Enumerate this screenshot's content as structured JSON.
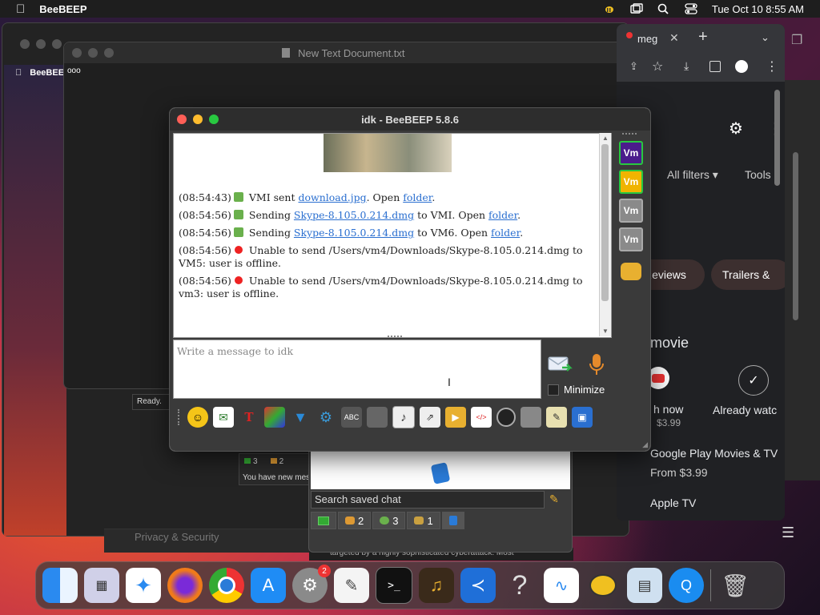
{
  "menubar": {
    "app_name": "BeeBEEP",
    "datetime": "Tue Oct 10  8:55 AM"
  },
  "background_windows": {
    "text_doc_title": "New Text Document.txt",
    "inner_app_name": "BeeBEEP",
    "status_ready": "Ready.",
    "notice_new_msg": "You have new mes",
    "notice_counts": [
      "3",
      "2"
    ],
    "privacy_label": "Privacy & Security",
    "news_snippet": "targeted by a highly sophisticated cyberattack. Most"
  },
  "chrome": {
    "tab_label": "meg",
    "all_filters": "All filters",
    "tools": "Tools",
    "chip_reviews": "Reviews",
    "chip_trailers": "Trailers &",
    "movie_heading": "movie",
    "watch_now": "h now",
    "price_1": "$3.99",
    "already_watched": "Already watc",
    "gp_title": "Google Play Movies & TV",
    "gp_price": "From $3.99",
    "apple_tv": "Apple TV"
  },
  "bee_window": {
    "title": "idk - BeeBEEP 5.8.6",
    "chat": [
      {
        "time": "(08:54:43)",
        "pre": " VMI sent ",
        "link1": "download.jpg",
        "mid": ". Open ",
        "link2": "folder",
        "post": ".",
        "kind": "dl"
      },
      {
        "time": "(08:54:56)",
        "pre": " Sending ",
        "link1": "Skype-8.105.0.214.dmg",
        "mid": " to VMI. Open ",
        "link2": "folder",
        "post": ".",
        "kind": "up"
      },
      {
        "time": "(08:54:56)",
        "pre": " Sending ",
        "link1": "Skype-8.105.0.214.dmg",
        "mid": " to VM6. Open ",
        "link2": "folder",
        "post": ".",
        "kind": "up"
      },
      {
        "time": "(08:54:56)",
        "text": " Unable to send /Users/vm4/Downloads/Skype-8.105.0.214.dmg to VM5: user is offline.",
        "kind": "err"
      },
      {
        "time": "(08:54:56)",
        "text": " Unable to send /Users/vm4/Downloads/Skype-8.105.0.214.dmg to vm3: user is offline.",
        "kind": "err"
      }
    ],
    "users": [
      {
        "label": "Vm",
        "color": "#4b1c8c",
        "border": "#28c840"
      },
      {
        "label": "Vm",
        "color": "#f0b400",
        "border": "#28c840"
      },
      {
        "label": "Vm",
        "color": "#8a8a8a",
        "border": "#aaaaaa"
      },
      {
        "label": "Vm",
        "color": "#8a8a8a",
        "border": "#aaaaaa"
      }
    ],
    "input_placeholder": "Write a message to idk",
    "minimize_label": "Minimize"
  },
  "low_panel": {
    "search_placeholder": "Search saved chat",
    "tab_counts": [
      "2",
      "3",
      "1"
    ]
  },
  "dock": {
    "settings_badge": "2"
  },
  "colors": {
    "link": "#2a6fd0",
    "error": "#e22222",
    "accent_green": "#28c840"
  }
}
